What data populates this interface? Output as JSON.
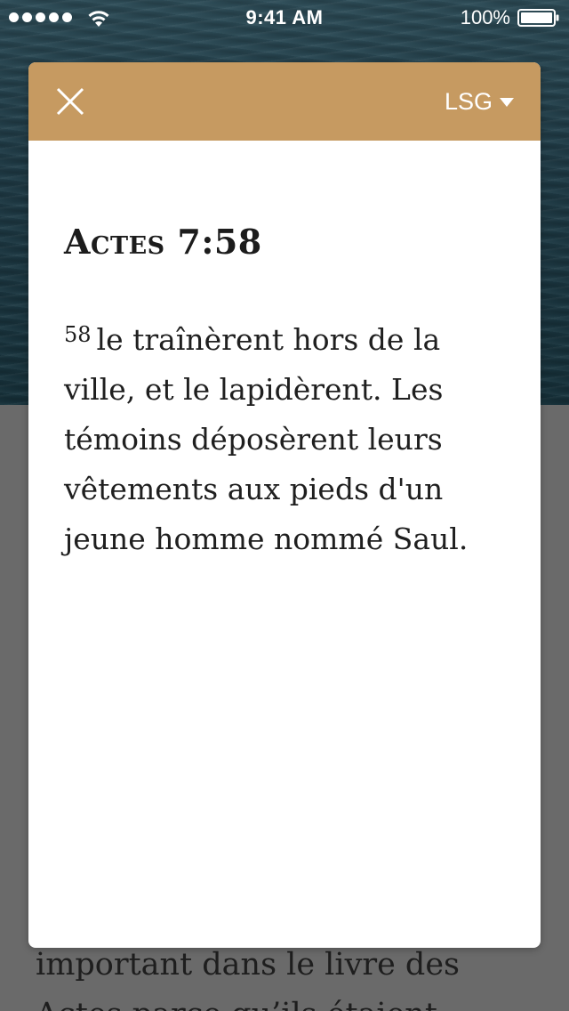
{
  "status_bar": {
    "time": "9:41 AM",
    "battery": "100%"
  },
  "background": {
    "article_text": "important dans le livre des\nActes parce qu’ils étaient"
  },
  "modal": {
    "version": "LSG",
    "reference": "Actes 7:58",
    "verse_number": "58",
    "verse_text": "le traînèrent hors de la ville, et le lapidèrent. Les témoins déposèrent leurs vêtements aux pieds d'un jeune homme nommé Saul."
  },
  "colors": {
    "header": "#c69a61",
    "overlay": "#6a6a6a"
  }
}
